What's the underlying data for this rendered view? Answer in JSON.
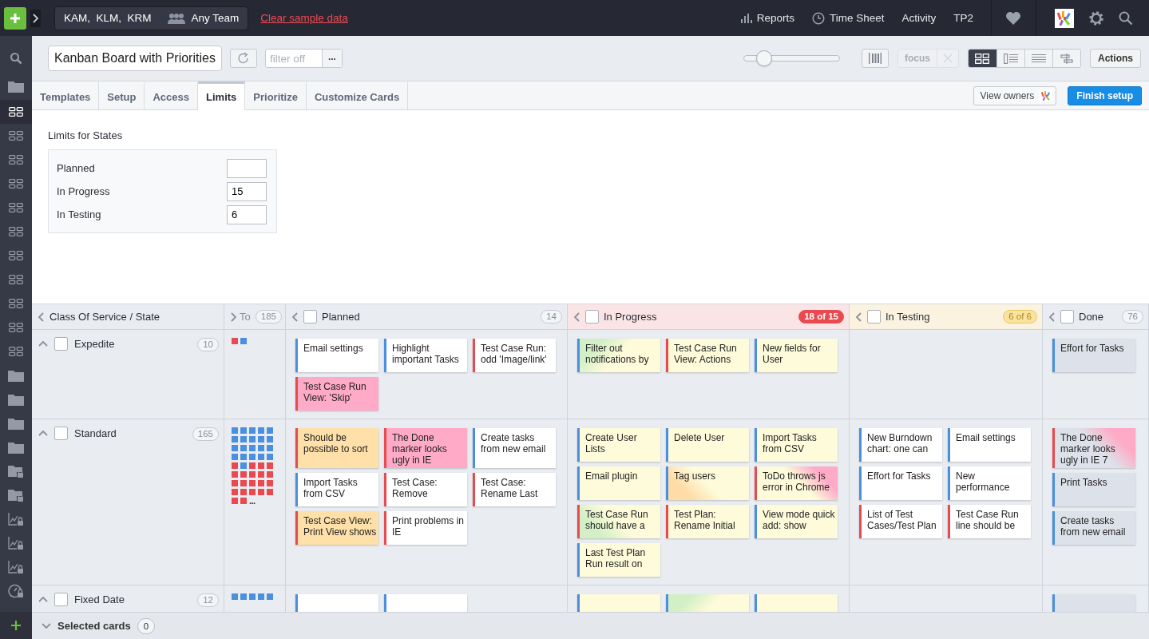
{
  "topbar": {
    "team_members": "KAM,  KLM,  KRM",
    "team": "Any Team",
    "clear_link": "Clear sample data",
    "nav": [
      {
        "label": "Reports",
        "kind": "chart"
      },
      {
        "label": "Time Sheet",
        "kind": "clock"
      },
      {
        "label": "Activity",
        "kind": "text"
      },
      {
        "label": "TP2",
        "kind": "text"
      }
    ]
  },
  "sidebar": {
    "items": [
      {
        "kind": "search",
        "selected": false
      },
      {
        "kind": "folder",
        "selected": false
      },
      {
        "kind": "board",
        "selected": true
      },
      {
        "kind": "board",
        "selected": false
      },
      {
        "kind": "board",
        "selected": false
      },
      {
        "kind": "board",
        "selected": false
      },
      {
        "kind": "board",
        "selected": false
      },
      {
        "kind": "board",
        "selected": false
      },
      {
        "kind": "board",
        "selected": false
      },
      {
        "kind": "board",
        "selected": false
      },
      {
        "kind": "board",
        "selected": false
      },
      {
        "kind": "board",
        "selected": false
      },
      {
        "kind": "board",
        "selected": false
      },
      {
        "kind": "folder",
        "selected": false
      },
      {
        "kind": "folder",
        "selected": false
      },
      {
        "kind": "folder",
        "selected": false
      },
      {
        "kind": "folder",
        "selected": false
      },
      {
        "kind": "folder-lock",
        "selected": false
      },
      {
        "kind": "folder-lock",
        "selected": false
      },
      {
        "kind": "chart-lock",
        "selected": false
      },
      {
        "kind": "chart-lock",
        "selected": false
      },
      {
        "kind": "chart-lock",
        "selected": false
      },
      {
        "kind": "gauge-lock",
        "selected": false
      }
    ]
  },
  "toolbar": {
    "board_title": "Kanban Board with Priorities",
    "filter": {
      "placeholder": "filter off"
    },
    "more_button": "...",
    "zoom": {
      "level": 0.18
    },
    "focus": {
      "label": "focus",
      "disabled": true
    },
    "view_modes": [
      {
        "kind": "grid",
        "selected": true
      },
      {
        "kind": "list",
        "selected": false
      },
      {
        "kind": "lines",
        "selected": false
      },
      {
        "kind": "tree",
        "selected": false
      }
    ],
    "actions": "Actions"
  },
  "tabs": [
    {
      "label": "Templates",
      "selected": false
    },
    {
      "label": "Setup",
      "selected": false
    },
    {
      "label": "Access",
      "selected": false
    },
    {
      "label": "Limits",
      "selected": true
    },
    {
      "label": "Prioritize",
      "selected": false
    },
    {
      "label": "Customize Cards",
      "selected": false
    }
  ],
  "tab_buttons": {
    "view_owners": "View owners",
    "finish_setup": "Finish setup"
  },
  "limits": {
    "title": "Limits for States",
    "rows": [
      {
        "state": "Planned"
      },
      {
        "state": "In Progress",
        "value": "15"
      },
      {
        "state": "In Testing",
        "value": "6"
      }
    ]
  },
  "board": {
    "corner": "Class Of Service / State",
    "columns": [
      {
        "name": "To",
        "count": "185",
        "over_limit": false,
        "at_limit": false,
        "collapsed": true
      },
      {
        "name": "Planned",
        "count": "14",
        "over_limit": false,
        "at_limit": false,
        "collapsed": false,
        "checked": false
      },
      {
        "name": "In Progress",
        "count": "18 of 15",
        "over_limit": true,
        "at_limit": false,
        "collapsed": false,
        "checked": false
      },
      {
        "name": "In Testing",
        "count": "6 of 6",
        "over_limit": false,
        "at_limit": true,
        "collapsed": false,
        "checked": false
      },
      {
        "name": "Done",
        "count": "76",
        "over_limit": false,
        "at_limit": false,
        "collapsed": false,
        "checked": false
      }
    ],
    "rows": [
      {
        "name": "Expedite",
        "count": "10",
        "expanded": true,
        "checked": false,
        "cells": [
          {
            "dots": [
              {
                "color": "#e84a50"
              },
              {
                "color": "#4a8fe0"
              }
            ]
          },
          {
            "cards": [
              {
                "text": "Email settings",
                "color": "#4a8fe0",
                "kind": "plain"
              },
              {
                "text": "Highlight important Tasks",
                "color": "#4a8fe0",
                "kind": "plain"
              },
              {
                "text": "Test Case Run: odd 'Image/link'",
                "color": "#e84a50",
                "kind": "plain"
              },
              {
                "text": "Test Case Run View: 'Skip'",
                "color": "#e84a50",
                "kind": "blocked"
              }
            ]
          },
          {
            "cards": [
              {
                "text": "Filter out notifications by",
                "color": "#4a8fe0",
                "kind": "active",
                "accent": {
                  "color": "#d3efc6",
                  "kind": "topleft"
                }
              },
              {
                "text": "Test Case Run View: Actions",
                "color": "#e84a50",
                "kind": "active"
              },
              {
                "text": "New fields for User",
                "color": "#4a8fe0",
                "kind": "active"
              }
            ]
          },
          {},
          {
            "cards": [
              {
                "text": "Effort for Tasks",
                "color": "#4a8fe0",
                "kind": "done"
              }
            ]
          }
        ]
      },
      {
        "name": "Standard",
        "count": "165",
        "expanded": true,
        "checked": false,
        "cells": [
          {
            "dots": [
              {
                "color": "#4a8fe0"
              },
              {
                "color": "#4a8fe0"
              },
              {
                "color": "#4a8fe0"
              },
              {
                "color": "#4a8fe0"
              },
              {
                "color": "#4a8fe0"
              },
              {
                "color": "#4a8fe0"
              },
              {
                "color": "#4a8fe0"
              },
              {
                "color": "#4a8fe0"
              },
              {
                "color": "#4a8fe0"
              },
              {
                "color": "#4a8fe0"
              },
              {
                "color": "#4a8fe0"
              },
              {
                "color": "#4a8fe0"
              },
              {
                "color": "#4a8fe0"
              },
              {
                "color": "#4a8fe0"
              },
              {
                "color": "#4a8fe0"
              },
              {
                "color": "#4a8fe0"
              },
              {
                "color": "#4a8fe0"
              },
              {
                "color": "#4a8fe0"
              },
              {
                "color": "#4a8fe0"
              },
              {
                "color": "#4a8fe0"
              },
              {
                "color": "#e84a50"
              },
              {
                "color": "#4a8fe0"
              },
              {
                "color": "#e84a50"
              },
              {
                "color": "#e84a50"
              },
              {
                "color": "#e84a50"
              },
              {
                "color": "#e84a50"
              },
              {
                "color": "#e84a50"
              },
              {
                "color": "#e84a50"
              },
              {
                "color": "#e84a50"
              },
              {
                "color": "#e84a50"
              },
              {
                "color": "#e84a50"
              },
              {
                "color": "#e84a50"
              },
              {
                "color": "#e84a50"
              },
              {
                "color": "#e84a50"
              },
              {
                "color": "#e84a50"
              },
              {
                "color": "#e84a50"
              },
              {
                "color": "#e84a50"
              },
              {
                "color": "#e84a50"
              },
              {
                "color": "#e84a50"
              },
              {
                "color": "#e84a50"
              },
              {
                "color": "#e84a50"
              },
              {
                "color": "#e84a50"
              }
            ],
            "more": "..."
          },
          {
            "cards": [
              {
                "text": "Should be possible to sort",
                "color": "#e84a50",
                "kind": "risk"
              },
              {
                "text": "The Done marker looks ugly in IE",
                "color": "#e84a50",
                "kind": "blocked"
              },
              {
                "text": "Create tasks from new email",
                "color": "#4a8fe0",
                "kind": "plain"
              },
              {
                "text": "Import Tasks from CSV",
                "color": "#4a8fe0",
                "kind": "plain"
              },
              {
                "text": "Test Case: Remove",
                "color": "#e84a50",
                "kind": "plain"
              },
              {
                "text": "Test Case: Rename Last",
                "color": "#e84a50",
                "kind": "plain"
              },
              {
                "text": "Test Case View: Print View shows",
                "color": "#e84a50",
                "kind": "risk"
              },
              {
                "text": "Print problems in IE",
                "color": "#e84a50",
                "kind": "plain"
              }
            ]
          },
          {
            "cards": [
              {
                "text": "Create User Lists",
                "color": "#4a8fe0",
                "kind": "active"
              },
              {
                "text": "Delete User",
                "color": "#4a8fe0",
                "kind": "active"
              },
              {
                "text": "Import Tasks from CSV",
                "color": "#4a8fe0",
                "kind": "active"
              },
              {
                "text": "Email plugin",
                "color": "#4a8fe0",
                "kind": "active"
              },
              {
                "text": "Tag users",
                "color": "#4a8fe0",
                "kind": "active",
                "accent": {
                  "color": "#ffdca6",
                  "kind": "bottomleft"
                }
              },
              {
                "text": "ToDo throws js error in Chrome",
                "color": "#e84a50",
                "kind": "active",
                "accent": {
                  "color": "#ffaac6",
                  "kind": "topright"
                }
              },
              {
                "text": "Test Case Run should have a",
                "color": "#e84a50",
                "kind": "active",
                "accent": {
                  "color": "#d3efc6",
                  "kind": "bottomleft"
                }
              },
              {
                "text": "Test Plan: Rename Initial",
                "color": "#e84a50",
                "kind": "active"
              },
              {
                "text": "View mode quick add: show",
                "color": "#4a8fe0",
                "kind": "active"
              },
              {
                "text": "Last Test Plan Run result on",
                "color": "#4a8fe0",
                "kind": "active"
              }
            ]
          },
          {
            "cards": [
              {
                "text": "New Burndown chart: one can",
                "color": "#4a8fe0",
                "kind": "plain"
              },
              {
                "text": "Email settings",
                "color": "#4a8fe0",
                "kind": "plain"
              },
              {
                "text": "Effort for Tasks",
                "color": "#4a8fe0",
                "kind": "plain"
              },
              {
                "text": "New performance",
                "color": "#4a8fe0",
                "kind": "plain"
              },
              {
                "text": "List of Test Cases/Test Plan",
                "color": "#e84a50",
                "kind": "plain"
              },
              {
                "text": "Test Case Run line should be",
                "color": "#e84a50",
                "kind": "plain"
              }
            ]
          },
          {
            "cards": [
              {
                "text": "The Done marker looks ugly in IE 7",
                "color": "#e84a50",
                "kind": "done",
                "accent": {
                  "color": "#ffaac6",
                  "kind": "topright"
                }
              },
              {
                "text": "Print Tasks",
                "color": "#4a8fe0",
                "kind": "done"
              },
              {
                "text": "Create tasks from new email",
                "color": "#4a8fe0",
                "kind": "done"
              }
            ]
          }
        ]
      },
      {
        "name": "Fixed Date",
        "count": "12",
        "expanded": true,
        "checked": false,
        "cells": [
          {
            "dots": [
              {
                "color": "#4a8fe0"
              },
              {
                "color": "#4a8fe0"
              },
              {
                "color": "#4a8fe0"
              },
              {
                "color": "#4a8fe0"
              },
              {
                "color": "#4a8fe0"
              }
            ]
          },
          {
            "cards": [
              {
                "color": "#4a8fe0",
                "kind": "plain"
              },
              {
                "color": "#4a8fe0",
                "kind": "plain"
              }
            ]
          },
          {
            "cards": [
              {
                "color": "#4a8fe0",
                "kind": "active"
              },
              {
                "color": "#4a8fe0",
                "kind": "active",
                "accent": {
                  "color": "#d3efc6",
                  "kind": "topleft"
                }
              },
              {
                "color": "#4a8fe0",
                "kind": "active"
              }
            ]
          },
          {},
          {
            "cards": [
              {
                "color": "#4a8fe0",
                "kind": "done"
              }
            ]
          }
        ]
      }
    ]
  },
  "footer": {
    "label": "Selected cards",
    "count": "0",
    "expanded": false
  }
}
